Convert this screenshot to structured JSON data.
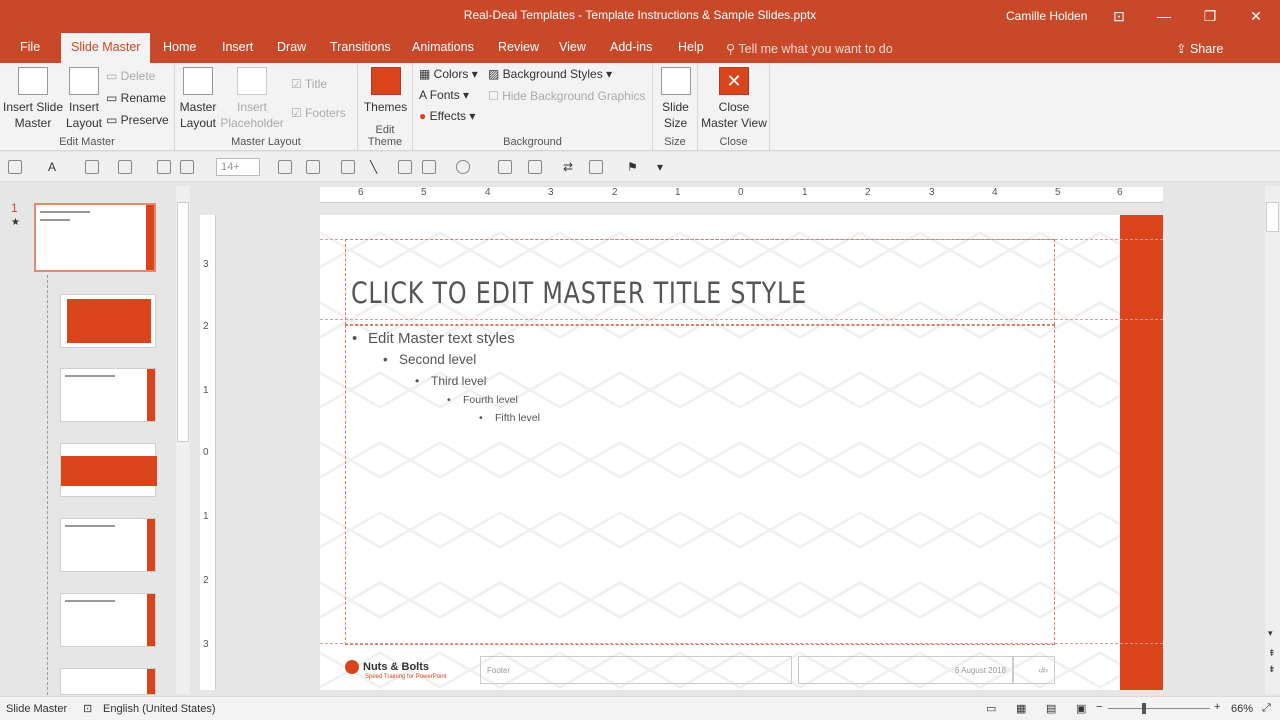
{
  "window": {
    "title": "Real-Deal Templates - Template Instructions & Sample Slides.pptx",
    "user": "Camille Holden"
  },
  "tabs": [
    "File",
    "Slide Master",
    "Home",
    "Insert",
    "Draw",
    "Transitions",
    "Animations",
    "Review",
    "View",
    "Add-ins",
    "Help"
  ],
  "tell_me": "Tell me what you want to do",
  "share": "Share",
  "ribbon": {
    "edit_master": {
      "label": "Edit Master",
      "insert_slide_master": "Insert Slide Master",
      "insert_layout": "Insert Layout",
      "delete": "Delete",
      "rename": "Rename",
      "preserve": "Preserve"
    },
    "master_layout": {
      "label": "Master Layout",
      "master_layout": "Master Layout",
      "insert_placeholder": "Insert Placeholder",
      "title": "Title",
      "footers": "Footers"
    },
    "edit_theme": {
      "label": "Edit Theme",
      "themes": "Themes"
    },
    "background": {
      "label": "Background",
      "colors": "Colors",
      "fonts": "Fonts",
      "effects": "Effects",
      "background_styles": "Background Styles",
      "hide_bg": "Hide Background Graphics"
    },
    "size": {
      "label": "Size",
      "slide_size": "Slide Size"
    },
    "close": {
      "label": "Close",
      "close_master": "Close Master View"
    }
  },
  "qat": {
    "font_size": "14+"
  },
  "thumb_number": "1",
  "ruler": {
    "h": [
      "6",
      "5",
      "4",
      "3",
      "2",
      "1",
      "0",
      "1",
      "2",
      "3",
      "4",
      "5",
      "6"
    ],
    "v": [
      "3",
      "2",
      "1",
      "0",
      "1",
      "2",
      "3"
    ]
  },
  "slide": {
    "title": "CLICK TO EDIT MASTER TITLE STYLE",
    "levels": [
      "Edit Master text styles",
      "Second level",
      "Third level",
      "Fourth level",
      "Fifth level"
    ],
    "logo": "Nuts & Bolts",
    "logo_sub": "Speed Training for PowerPoint",
    "footer": "Footer",
    "date": "6 August 2018",
    "number": "‹#›"
  },
  "status": {
    "mode": "Slide Master",
    "language": "English (United States)",
    "zoom": "66%"
  },
  "colors": {
    "accent": "#d9441b",
    "titlebar": "#c8492a"
  }
}
